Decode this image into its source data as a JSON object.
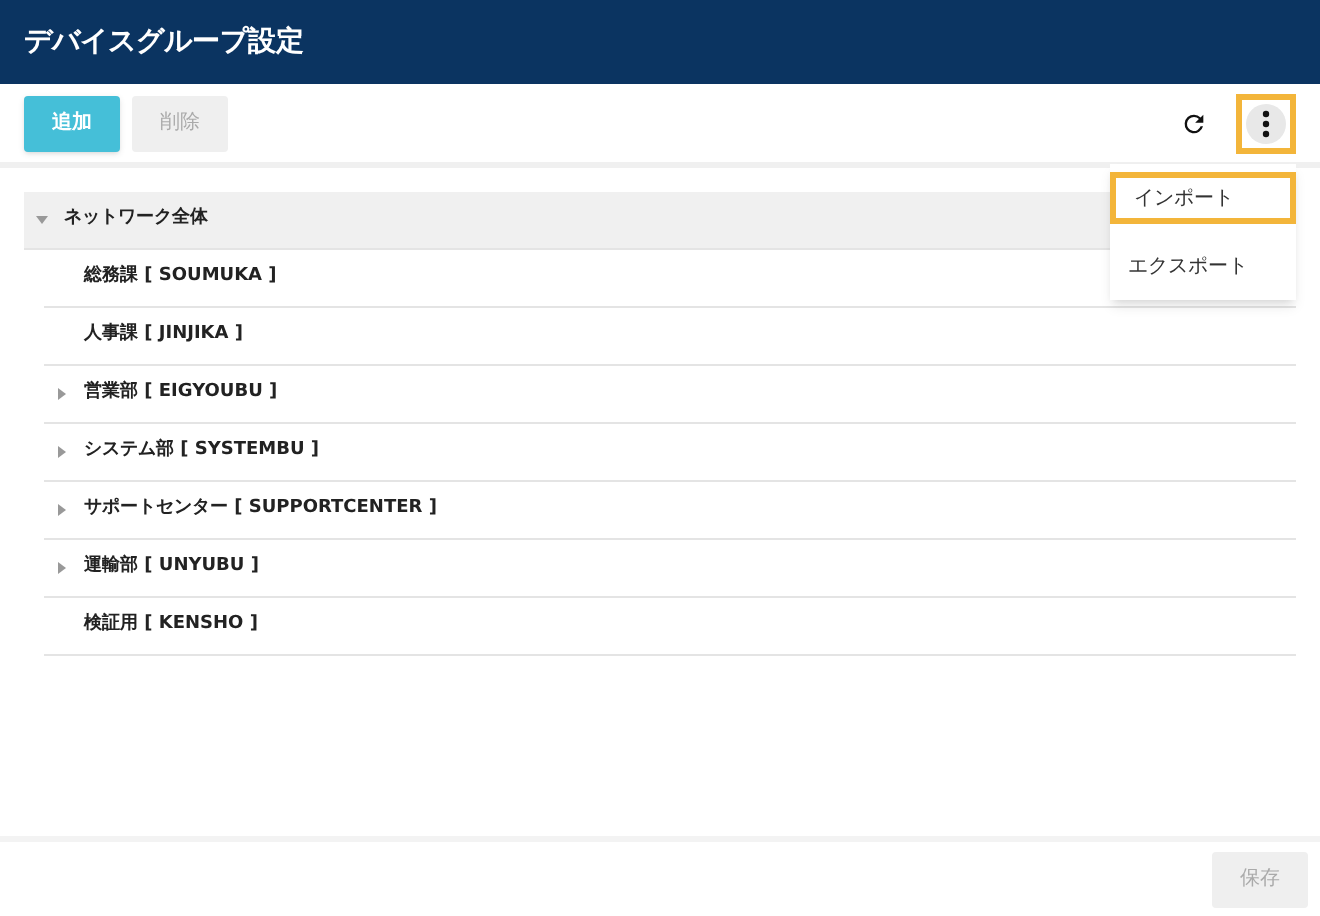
{
  "header": {
    "title": "デバイスグループ設定"
  },
  "toolbar": {
    "buttons": [
      {
        "label": "追加",
        "disabled": false
      },
      {
        "label": "削除",
        "disabled": true
      }
    ],
    "more_highlighted": true
  },
  "menu": [
    {
      "label": "インポート",
      "highlighted": true
    },
    {
      "label": "エクスポート",
      "highlighted": false
    }
  ],
  "tree": [
    {
      "label": "ネットワーク全体",
      "kind": "folder",
      "expanded": true,
      "children": [
        {
          "label": "総務課 [ SOUMUKA ]",
          "kind": "leaf"
        },
        {
          "label": "人事課 [ JINJIKA ]",
          "kind": "leaf"
        },
        {
          "label": "営業部 [ EIGYOUBU ]",
          "kind": "folder",
          "expanded": false
        },
        {
          "label": "システム部 [ SYSTEMBU ]",
          "kind": "folder",
          "expanded": false
        },
        {
          "label": "サポートセンター [ SUPPORTCENTER ]",
          "kind": "folder",
          "expanded": false
        },
        {
          "label": "運輸部 [ UNYUBU ]",
          "kind": "folder",
          "expanded": false
        },
        {
          "label": "検証用 [ KENSHO ]",
          "kind": "leaf"
        }
      ]
    }
  ],
  "footer": {
    "save": {
      "label": "保存",
      "disabled": true
    }
  }
}
